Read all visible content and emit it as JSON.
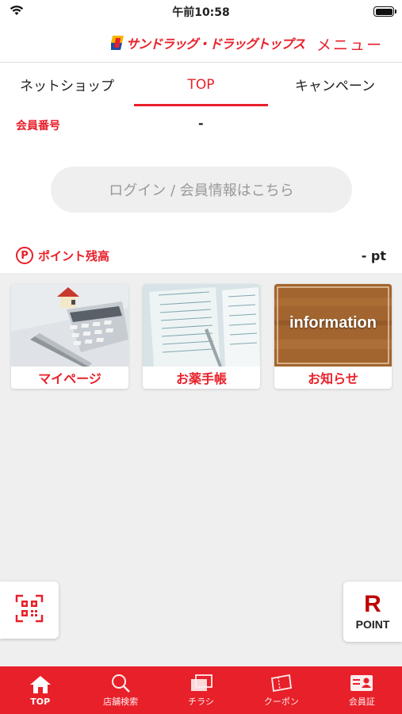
{
  "status_bar": {
    "time": "午前10:58"
  },
  "header": {
    "logo_text": "サンドラッグ・ドラッグトップス",
    "menu_label": "メニュー"
  },
  "tabs": [
    {
      "label": "ネットショップ",
      "active": false
    },
    {
      "label": "TOP",
      "active": true
    },
    {
      "label": "キャンペーン",
      "active": false
    }
  ],
  "member": {
    "number_label": "会員番号",
    "number_value": "-",
    "login_button": "ログイン / 会員情報はこちら"
  },
  "points": {
    "icon_letter": "P",
    "label": "ポイント残高",
    "value": "-  pt"
  },
  "cards": [
    {
      "label": "マイページ",
      "icon": "calculator-photo"
    },
    {
      "label": "お薬手帳",
      "icon": "medicine-notebook-photo"
    },
    {
      "label": "お知らせ",
      "icon": "information-board",
      "image_text": "information"
    }
  ],
  "floating": {
    "qr_icon": "qr-code-icon",
    "rpoint_letter": "R",
    "rpoint_text": "POINT"
  },
  "bottom_nav": [
    {
      "label": "TOP",
      "icon": "home-icon",
      "active": true
    },
    {
      "label": "店舗検索",
      "icon": "search-icon",
      "active": false
    },
    {
      "label": "チラシ",
      "icon": "flyer-icon",
      "active": false
    },
    {
      "label": "クーポン",
      "icon": "coupon-icon",
      "active": false
    },
    {
      "label": "会員証",
      "icon": "member-card-icon",
      "active": false
    }
  ],
  "colors": {
    "accent": "#e8202a",
    "rakuten": "#bf0000"
  }
}
